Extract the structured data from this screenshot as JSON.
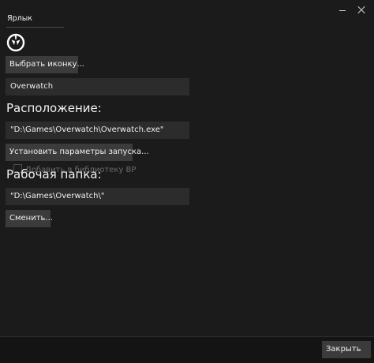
{
  "window": {
    "tab_label": "Ярлык"
  },
  "icon": {
    "name": "overwatch-logo-icon",
    "color": "#ffffff"
  },
  "buttons": {
    "choose_icon": "Выбрать иконку...",
    "launch_params": "Установить параметры запуска...",
    "change": "Сменить...",
    "close": "Закрыть"
  },
  "fields": {
    "name": "Overwatch",
    "path": "\"D:\\Games\\Overwatch\\Overwatch.exe\"",
    "workdir": "\"D:\\Games\\Overwatch\\\""
  },
  "headings": {
    "location": "Расположение:",
    "workdir": "Рабочая папка:"
  },
  "checkbox": {
    "label": "Добавить в библиотеку BP",
    "checked": false
  },
  "colors": {
    "background": "#1b1b1b",
    "button": "#3b3b3b",
    "field": "#2c2c2c"
  }
}
